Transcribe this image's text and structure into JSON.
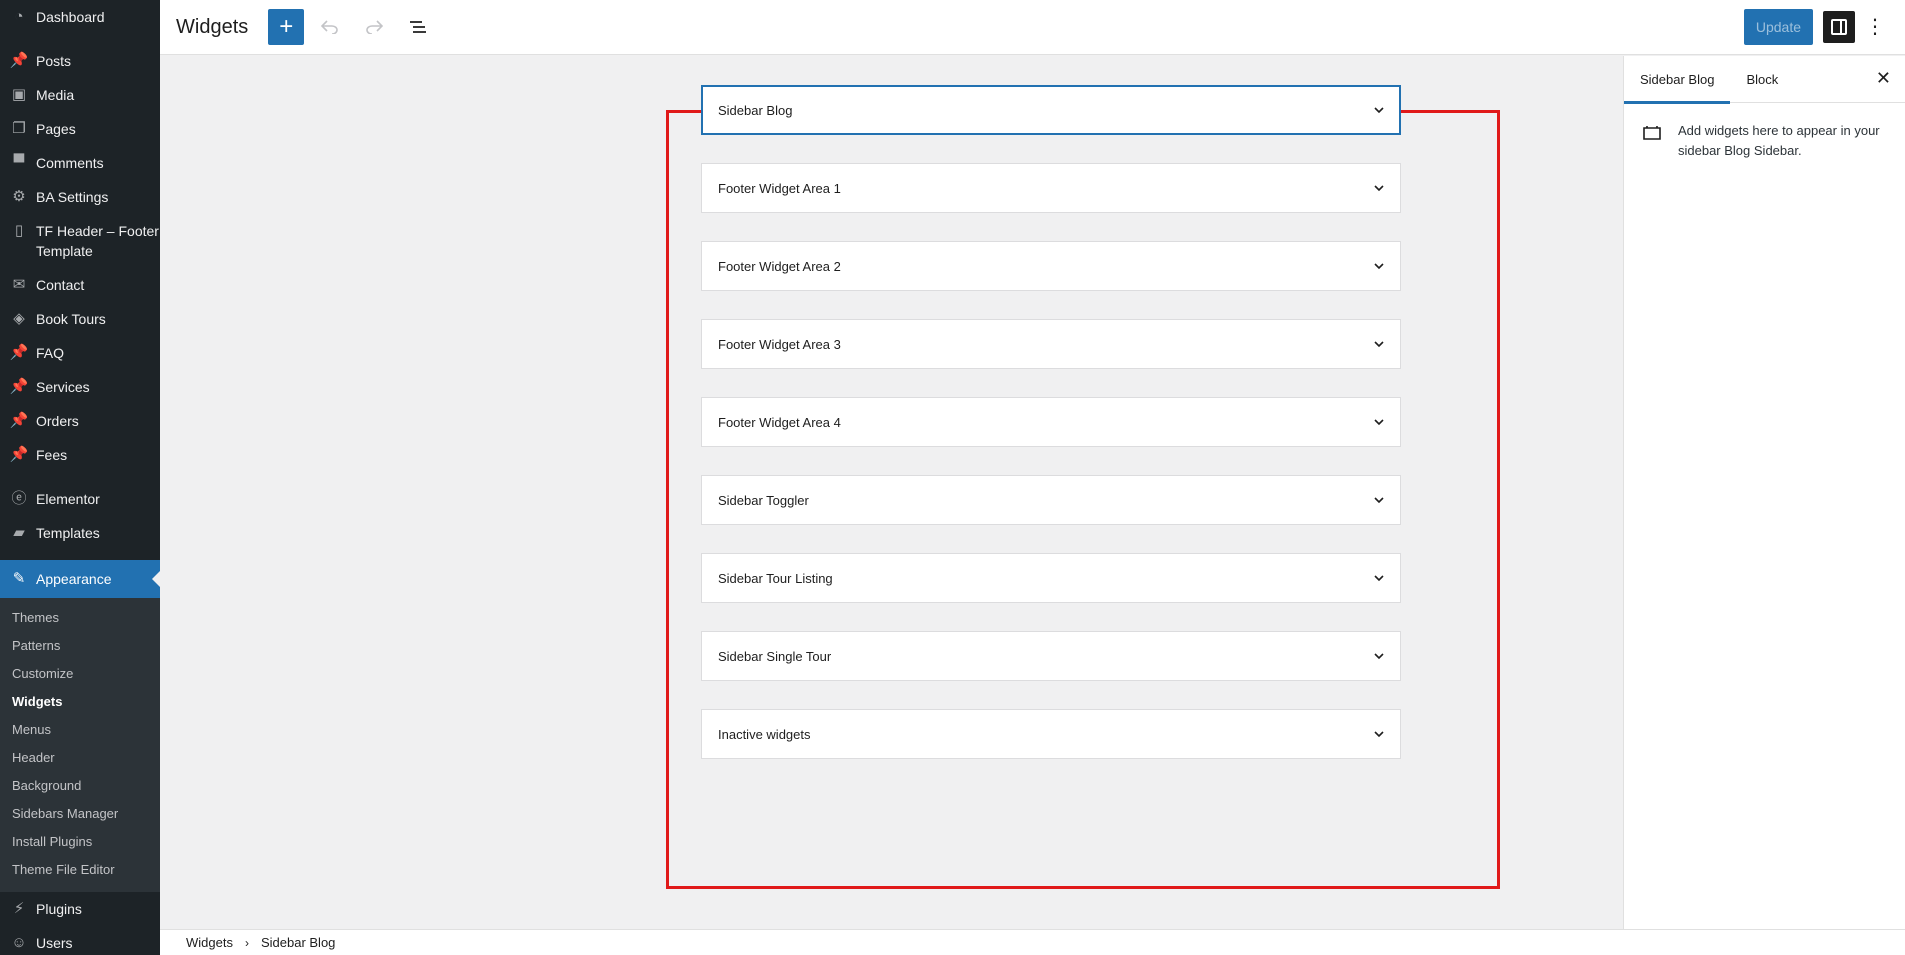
{
  "admin_menu": {
    "items_top": [
      {
        "label": "Dashboard",
        "icon": "dashboard-icon"
      },
      {
        "label": "Posts",
        "icon": "pin-icon"
      },
      {
        "label": "Media",
        "icon": "media-icon"
      },
      {
        "label": "Pages",
        "icon": "pages-icon"
      },
      {
        "label": "Comments",
        "icon": "comments-icon"
      },
      {
        "label": "BA Settings",
        "icon": "gear-icon"
      },
      {
        "label": "TF Header – Footer Template",
        "icon": "document-icon"
      },
      {
        "label": "Contact",
        "icon": "mail-icon"
      },
      {
        "label": "Book Tours",
        "icon": "tag-icon"
      },
      {
        "label": "FAQ",
        "icon": "pin-icon"
      },
      {
        "label": "Services",
        "icon": "pin-icon"
      },
      {
        "label": "Orders",
        "icon": "pin-icon"
      },
      {
        "label": "Fees",
        "icon": "pin-icon"
      }
    ],
    "items_mid": [
      {
        "label": "Elementor",
        "icon": "elementor-icon"
      },
      {
        "label": "Templates",
        "icon": "folder-icon"
      }
    ],
    "active": {
      "label": "Appearance",
      "icon": "brush-icon"
    },
    "submenu": [
      {
        "label": "Themes"
      },
      {
        "label": "Patterns"
      },
      {
        "label": "Customize"
      },
      {
        "label": "Widgets",
        "current": true
      },
      {
        "label": "Menus"
      },
      {
        "label": "Header"
      },
      {
        "label": "Background"
      },
      {
        "label": "Sidebars Manager"
      },
      {
        "label": "Install Plugins"
      },
      {
        "label": "Theme File Editor"
      }
    ],
    "items_bottom": [
      {
        "label": "Plugins",
        "icon": "plugin-icon"
      },
      {
        "label": "Users",
        "icon": "users-icon"
      }
    ]
  },
  "header": {
    "title": "Widgets",
    "add_label": "+",
    "update_label": "Update"
  },
  "widget_areas": [
    {
      "title": "Sidebar Blog",
      "selected": true
    },
    {
      "title": "Footer Widget Area 1"
    },
    {
      "title": "Footer Widget Area 2"
    },
    {
      "title": "Footer Widget Area 3"
    },
    {
      "title": "Footer Widget Area 4"
    },
    {
      "title": "Sidebar Toggler"
    },
    {
      "title": "Sidebar Tour Listing"
    },
    {
      "title": "Sidebar Single Tour"
    },
    {
      "title": "Inactive widgets"
    }
  ],
  "sidebar_panel": {
    "tab_area": "Sidebar Blog",
    "tab_block": "Block",
    "description": "Add widgets here to appear in your sidebar Blog Sidebar."
  },
  "breadcrumb": {
    "root": "Widgets",
    "current": "Sidebar Blog"
  },
  "colors": {
    "accent": "#2271b1",
    "admin_bg": "#1d2327",
    "highlight_border": "#e01919"
  }
}
